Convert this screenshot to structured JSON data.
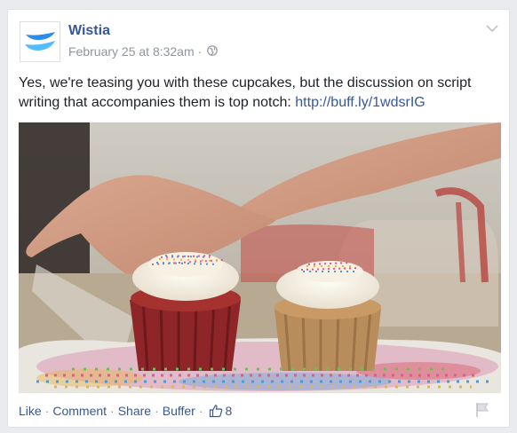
{
  "post": {
    "author": "Wistia",
    "timestamp": "February 25 at 8:32am",
    "meta_separator": "·",
    "privacy_icon": "globe-icon",
    "text": "Yes, we're teasing you with these cupcakes, but the discussion on script writing that accompanies them is top notch:",
    "link_text": "http://buff.ly/1wdsrIG",
    "photo_alt": "A hand sprinkling colorful sprinkles near a red velvet cupcake and a chocolate cupcake with white frosting"
  },
  "actions": {
    "like": "Like",
    "comment": "Comment",
    "share": "Share",
    "buffer": "Buffer",
    "separator": "·",
    "like_count": "8"
  },
  "colors": {
    "brand_link": "#365899",
    "wistia_blue": "#2b8ced",
    "text": "#1d2129",
    "meta": "#90949c"
  }
}
